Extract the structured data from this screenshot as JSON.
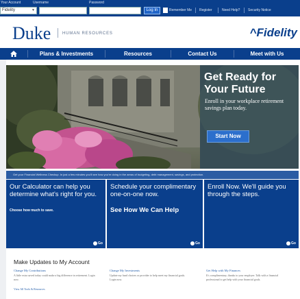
{
  "login_bar": {
    "account_label": "Your Account",
    "username_label": "Username",
    "password_label": "Password",
    "account_select_value": "Fidelity",
    "login_button": "Log In",
    "remember_label": "Remember Me",
    "links": [
      "Register",
      "Need Help?",
      "Security Notice"
    ]
  },
  "header": {
    "logo": "Duke",
    "department": "HUMAN RESOURCES",
    "partner": "Fidelity"
  },
  "nav": {
    "items": [
      "Plans & Investments",
      "Resources",
      "Contact Us",
      "Meet with Us"
    ]
  },
  "hero": {
    "title": "Get Ready for Your Future",
    "subtitle": "Enroll in your workplace retirement savings plan today.",
    "button": "Start Now"
  },
  "strip": {
    "text": "Get your Financial Wellness Checkup. In just a few minutes you'll see how you're doing in the areas of budgeting, debt management, savings, and protection."
  },
  "promos": [
    {
      "main": "Our Calculator can help you determine what's right for you.",
      "small": "Choose how much to save.",
      "go": "Go"
    },
    {
      "main": "Schedule your complimentary one-on-one now.",
      "sub": "See How We Can Help",
      "go": "Go"
    },
    {
      "main": "Enroll Now. We'll guide you through the steps.",
      "go": "Go"
    }
  ],
  "updates": {
    "title": "Make Updates to My Account",
    "columns": [
      {
        "head": "Change My Contributions",
        "text": "A little extra saved today could make a big difference in retirement. Login now."
      },
      {
        "head": "Change My Investments",
        "text": "Update my fund choices or provider to help meet my financial goals. Login now."
      },
      {
        "head": "Get Help with My Finances",
        "text": "It's complimentary, thanks to your employer. Talk with a financial professional to get help with your financial goals."
      }
    ],
    "view_all": "View All Tools & Resources"
  },
  "colors": {
    "brand_blue": "#0a3f8c",
    "button_blue": "#2c6fcc",
    "link_blue": "#1f5aa8"
  }
}
